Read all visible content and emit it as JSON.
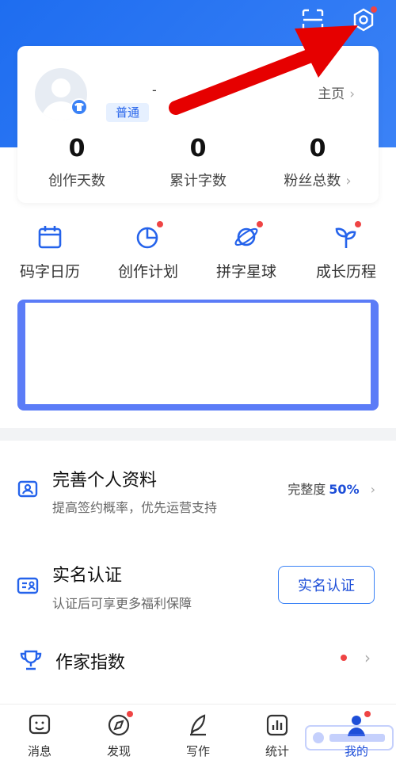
{
  "colors": {
    "accent": "#1d4ed8",
    "hero": "#1e6df0",
    "dot": "#ef4444",
    "arrow": "#e60000"
  },
  "header": {
    "scan_icon": "scan-icon",
    "settings_icon": "gear-icon"
  },
  "profile": {
    "tier": "普通",
    "username": "-",
    "homepage_label": "主页",
    "stats": [
      {
        "value": "0",
        "label": "创作天数"
      },
      {
        "value": "0",
        "label": "累计字数"
      },
      {
        "value": "0",
        "label": "粉丝总数"
      }
    ]
  },
  "quick_actions": [
    {
      "label": "码字日历",
      "icon": "calendar-icon"
    },
    {
      "label": "创作计划",
      "icon": "pie-chart-icon"
    },
    {
      "label": "拼字星球",
      "icon": "planet-icon"
    },
    {
      "label": "成长历程",
      "icon": "sprout-icon"
    }
  ],
  "profile_completion": {
    "title": "完善个人资料",
    "subtitle": "提高签约概率，优先运营支持",
    "completion_label": "完整度",
    "completion_value": "50%"
  },
  "real_name": {
    "title": "实名认证",
    "subtitle": "认证后可享更多福利保障",
    "button_label": "实名认证"
  },
  "author_index": {
    "title": "作家指数"
  },
  "tabs": [
    {
      "label": "消息",
      "icon": "message-icon"
    },
    {
      "label": "发现",
      "icon": "compass-icon"
    },
    {
      "label": "写作",
      "icon": "pen-icon"
    },
    {
      "label": "统计",
      "icon": "stats-icon"
    },
    {
      "label": "我的",
      "icon": "user-icon"
    }
  ]
}
